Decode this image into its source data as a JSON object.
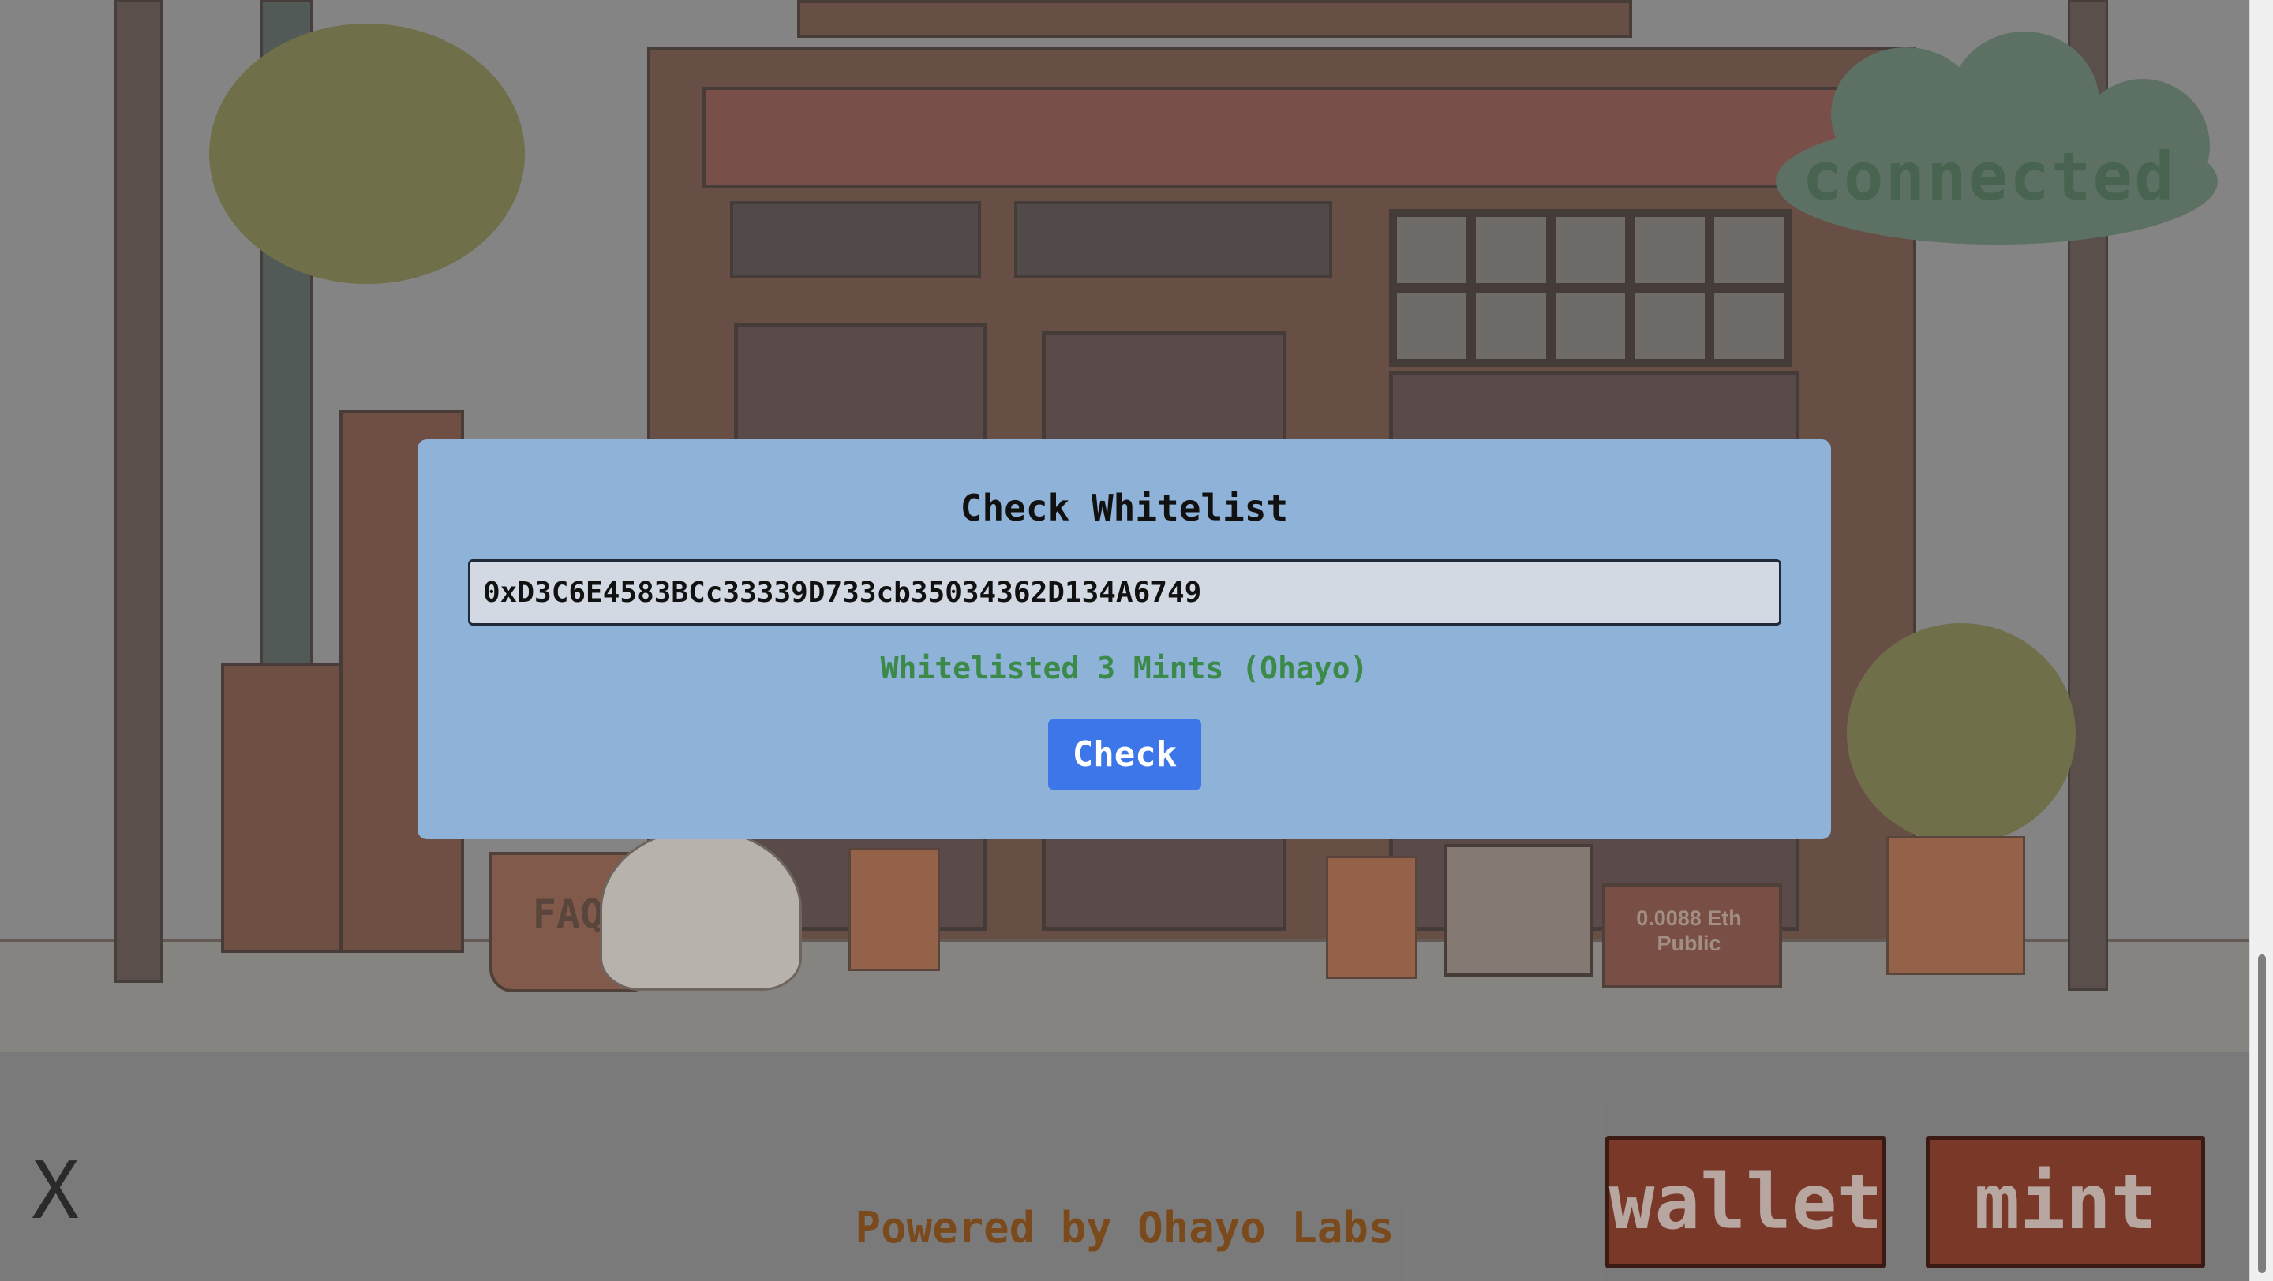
{
  "header": {
    "status_badge": "connected"
  },
  "modal": {
    "title": "Check Whitelist",
    "address_value": "0xD3C6E4583BCc33339D733cb35034362D134A6749",
    "result_text": "Whitelisted 3 Mints (Ohayo)",
    "check_label": "Check"
  },
  "scene": {
    "faq_label": "FAQ",
    "price_label": "0.0088 Eth\nPublic"
  },
  "footer": {
    "close_label": "X",
    "powered_by": "Powered by Ohayo Labs",
    "wallet_label": "wallet",
    "mint_label": "mint"
  },
  "colors": {
    "modal_bg": "#8fb2d9",
    "check_button": "#3d76e8",
    "status_green": "#3b8a4a",
    "connected_cloud": "#4e6e58",
    "sign_bg": "#7a3828"
  },
  "icons": {
    "close": "close-icon"
  }
}
